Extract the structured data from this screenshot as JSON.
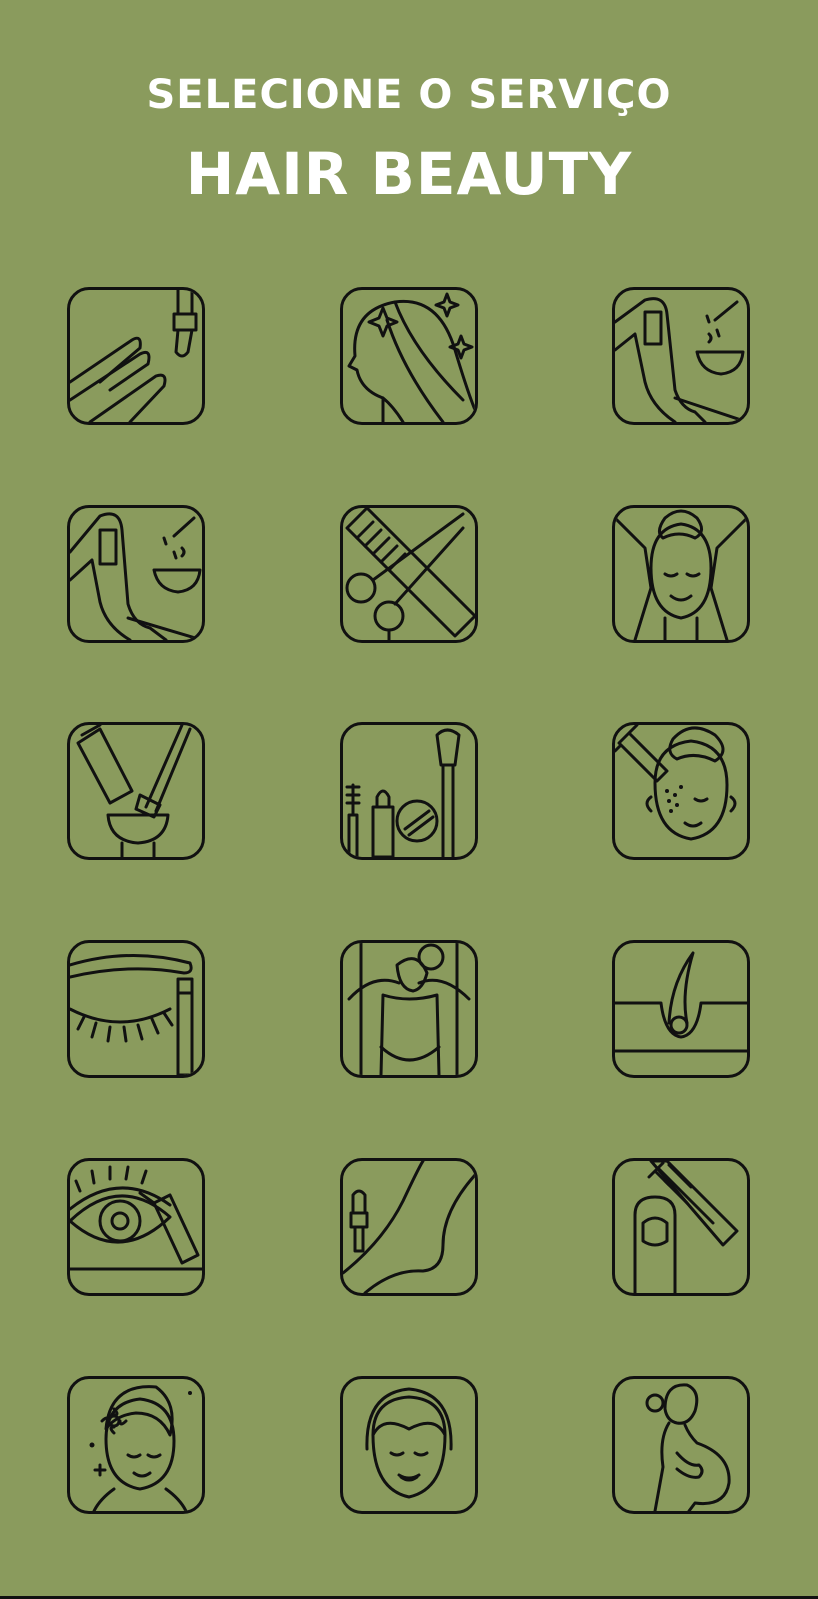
{
  "header": {
    "subtitle": "SELECIONE O SERVIÇO",
    "title": "HAIR BEAUTY"
  },
  "colors": {
    "background": "#8a9b5d",
    "text": "#ffffff",
    "icon_stroke": "#111111"
  },
  "services": [
    {
      "icon": "nail-polish-icon"
    },
    {
      "icon": "hair-shine-icon"
    },
    {
      "icon": "leg-wax-icon"
    },
    {
      "icon": "body-wax-icon"
    },
    {
      "icon": "comb-scissors-icon"
    },
    {
      "icon": "face-massage-icon"
    },
    {
      "icon": "hair-dye-icon"
    },
    {
      "icon": "makeup-icon"
    },
    {
      "icon": "facial-injection-icon"
    },
    {
      "icon": "eyelash-icon"
    },
    {
      "icon": "body-massage-icon"
    },
    {
      "icon": "hair-removal-icon"
    },
    {
      "icon": "eye-makeup-icon"
    },
    {
      "icon": "pedicure-icon"
    },
    {
      "icon": "nail-file-icon"
    },
    {
      "icon": "flower-facial-icon"
    },
    {
      "icon": "towel-facial-icon"
    },
    {
      "icon": "pregnancy-icon"
    }
  ]
}
